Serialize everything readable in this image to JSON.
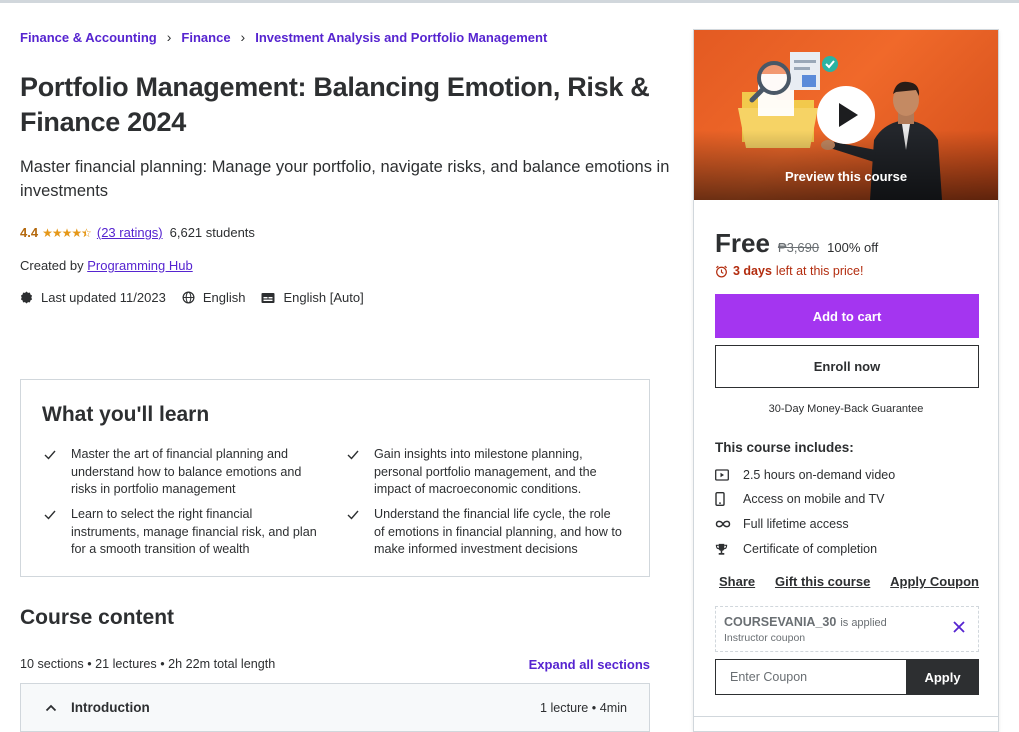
{
  "breadcrumb": [
    "Finance & Accounting",
    "Finance",
    "Investment Analysis and Portfolio Management"
  ],
  "course": {
    "title": "Portfolio Management: Balancing Emotion, Risk & Finance 2024",
    "subtitle": "Master financial planning: Manage your portfolio, navigate risks, and balance emotions in investments",
    "rating": "4.4",
    "rating_stars": 4.4,
    "ratings_count": "(23 ratings)",
    "students": "6,621 students",
    "created_by_label": "Created by",
    "instructor": "Programming Hub",
    "last_updated": "Last updated 11/2023",
    "language": "English",
    "captions": "English [Auto]"
  },
  "learn": {
    "title": "What you'll learn",
    "items": [
      "Master the art of financial planning and understand how to balance emotions and risks in portfolio management",
      "Gain insights into milestone planning, personal portfolio management, and the impact of macroeconomic conditions.",
      "Learn to select the right financial instruments, manage financial risk, and plan for a smooth transition of wealth",
      "Understand the financial life cycle, the role of emotions in financial planning, and how to make informed investment decisions"
    ]
  },
  "content": {
    "title": "Course content",
    "summary": "10 sections • 21 lectures • 2h 22m total length",
    "expand_label": "Expand all sections",
    "sections": [
      {
        "name": "Introduction",
        "info": "1 lecture • 4min"
      }
    ]
  },
  "sidebar": {
    "preview_caption": "Preview this course",
    "price": "Free",
    "original_price": "₱3,690",
    "discount": "100% off",
    "timer_bold": "3 days",
    "timer_rest": "left at this price!",
    "add_to_cart": "Add to cart",
    "enroll_now": "Enroll now",
    "guarantee": "30-Day Money-Back Guarantee",
    "includes_title": "This course includes:",
    "includes": [
      {
        "icon": "video-icon",
        "label": "2.5 hours on-demand video"
      },
      {
        "icon": "mobile-icon",
        "label": "Access on mobile and TV"
      },
      {
        "icon": "infinity-icon",
        "label": "Full lifetime access"
      },
      {
        "icon": "trophy-icon",
        "label": "Certificate of completion"
      }
    ],
    "links": {
      "share": "Share",
      "gift": "Gift this course",
      "apply_coupon": "Apply Coupon"
    },
    "coupon": {
      "code": "COURSEVANIA_30",
      "applied": "is applied",
      "sub": "Instructor coupon"
    },
    "coupon_input_placeholder": "Enter Coupon",
    "apply_button": "Apply"
  },
  "colors": {
    "brand_purple": "#5624d0",
    "cart_purple": "#a435f0",
    "rating_orange": "#b4690e",
    "star_color": "#e59819",
    "timer_red": "#b32d0f",
    "text_dark": "#2d2f31",
    "preview_orange": "#f0692a"
  }
}
